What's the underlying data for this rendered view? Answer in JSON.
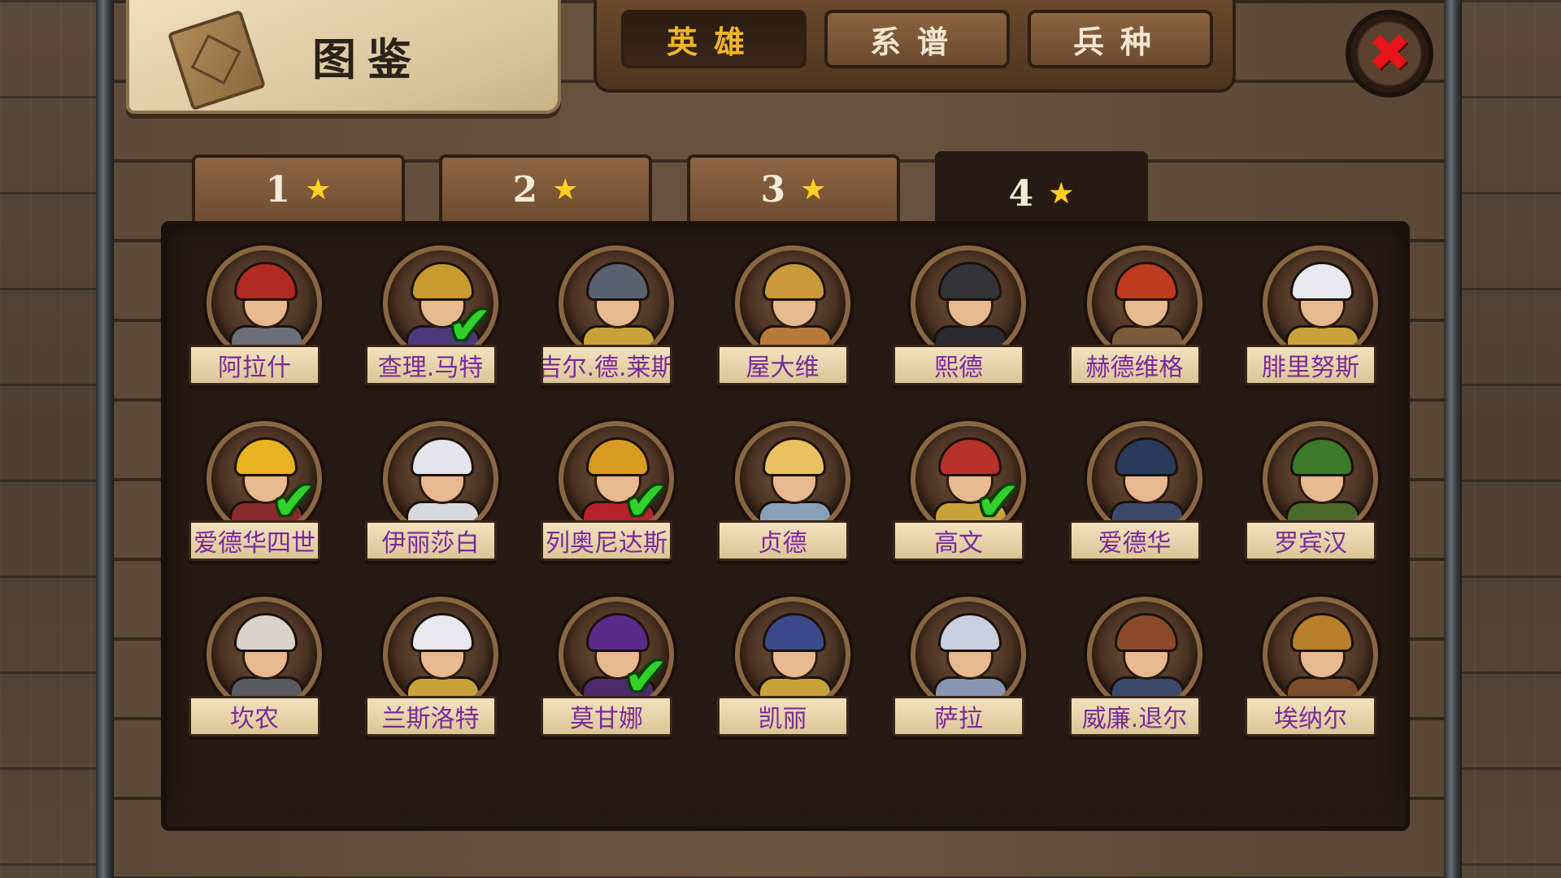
{
  "title": {
    "text": "图鉴",
    "icon": "book-icon"
  },
  "category_tabs": [
    {
      "label": "英雄",
      "active": true
    },
    {
      "label": "系谱",
      "active": false
    },
    {
      "label": "兵种",
      "active": false
    }
  ],
  "close_button": {
    "icon": "close-x-icon",
    "glyph": "✖"
  },
  "star_tabs": [
    {
      "num": "1",
      "star": "★",
      "active": false
    },
    {
      "num": "2",
      "star": "★",
      "active": false
    },
    {
      "num": "3",
      "star": "★",
      "active": false
    },
    {
      "num": "4",
      "star": "★",
      "active": true
    }
  ],
  "check_glyph": "✔",
  "colors": {
    "active_tab_text": "#f0b528",
    "name_text": "#7a2a9a",
    "check": "#2fd12a",
    "close": "#e8141a",
    "star": "#ffcf26"
  },
  "heroes": [
    {
      "name": "阿拉什",
      "owned": false,
      "helm": "#b22a22",
      "body": "#6c6f7a"
    },
    {
      "name": "查理.马特",
      "owned": true,
      "helm": "#c99a2e",
      "body": "#4a3a7a"
    },
    {
      "name": "吉尔.德.莱斯",
      "owned": false,
      "helm": "#5a6270",
      "body": "#c9a23a"
    },
    {
      "name": "屋大维",
      "owned": false,
      "helm": "#c99a3a",
      "body": "#b87a3a"
    },
    {
      "name": "熙德",
      "owned": false,
      "helm": "#333338",
      "body": "#2a2a2e"
    },
    {
      "name": "赫德维格",
      "owned": false,
      "helm": "#c03a22",
      "body": "#7a5a3a"
    },
    {
      "name": "腓里努斯",
      "owned": false,
      "helm": "#e8e8ee",
      "body": "#c9a23a"
    },
    {
      "name": "爱德华四世",
      "owned": true,
      "helm": "#e8b320",
      "body": "#8a2a2a"
    },
    {
      "name": "伊丽莎白",
      "owned": false,
      "helm": "#e4e4ea",
      "body": "#d8d8e0"
    },
    {
      "name": "列奥尼达斯",
      "owned": true,
      "helm": "#d99a22",
      "body": "#b8222a"
    },
    {
      "name": "贞德",
      "owned": false,
      "helm": "#e8c060",
      "body": "#8aa0b8"
    },
    {
      "name": "高文",
      "owned": true,
      "helm": "#b8302a",
      "body": "#c9a23a"
    },
    {
      "name": "爱德华",
      "owned": false,
      "helm": "#2a3a5a",
      "body": "#3a4a6a"
    },
    {
      "name": "罗宾汉",
      "owned": false,
      "helm": "#3a7a2a",
      "body": "#4a6a2a"
    },
    {
      "name": "坎农",
      "owned": false,
      "helm": "#d8d4cc",
      "body": "#5a5a62"
    },
    {
      "name": "兰斯洛特",
      "owned": false,
      "helm": "#e8e8ee",
      "body": "#c9a23a"
    },
    {
      "name": "莫甘娜",
      "owned": true,
      "helm": "#5a2a8a",
      "body": "#4a2a6a"
    },
    {
      "name": "凯丽",
      "owned": false,
      "helm": "#3a4a8a",
      "body": "#c9a23a"
    },
    {
      "name": "萨拉",
      "owned": false,
      "helm": "#c8d0e0",
      "body": "#8a96b0"
    },
    {
      "name": "威廉.退尔",
      "owned": false,
      "helm": "#8a4a2a",
      "body": "#3a4a6a"
    },
    {
      "name": "埃纳尔",
      "owned": false,
      "helm": "#b8802a",
      "body": "#7a4a2a"
    }
  ]
}
